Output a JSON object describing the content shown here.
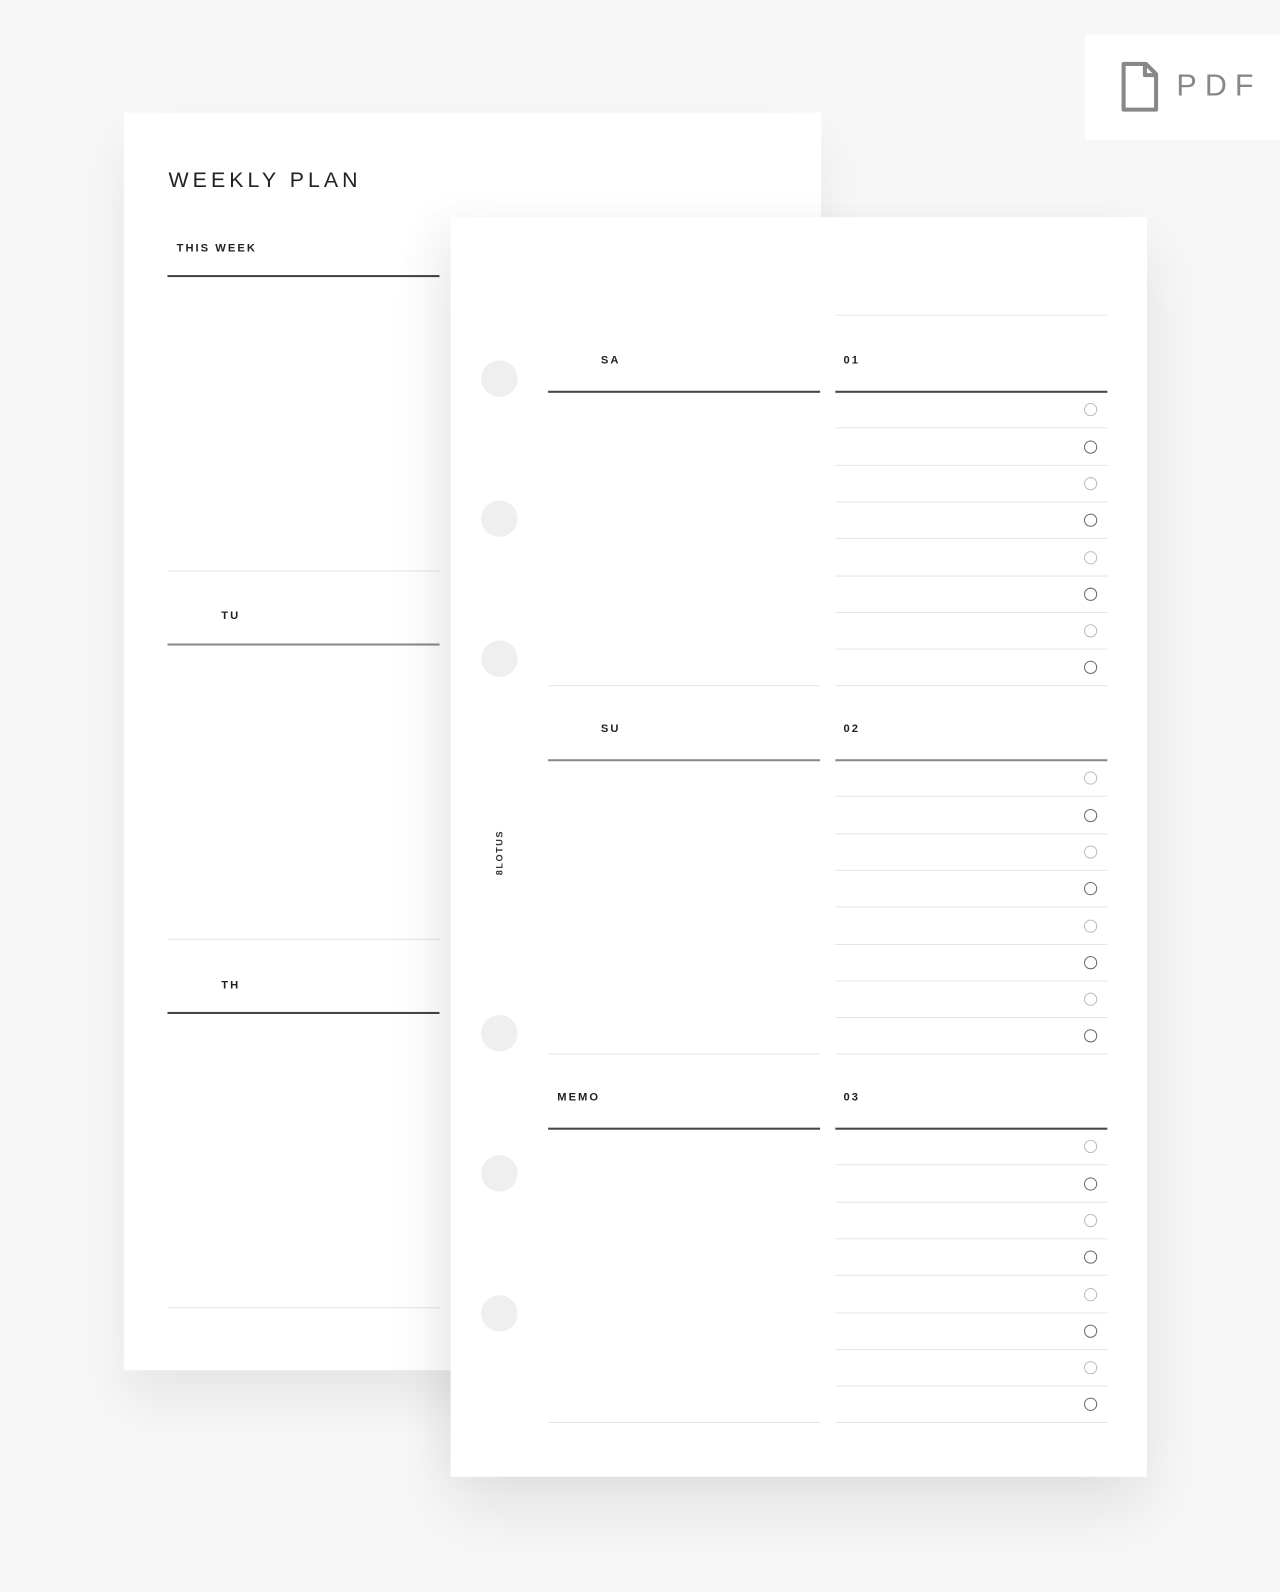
{
  "badge": {
    "label": "PDF",
    "icon": "file-icon"
  },
  "back_page": {
    "title": "WEEKLY PLAN",
    "sections": [
      "THIS WEEK",
      "TU",
      "TH"
    ]
  },
  "front_page": {
    "brand": "8LOTUS",
    "left_sections": [
      "SA",
      "SU",
      "MEMO"
    ],
    "right_sections": [
      "01",
      "02",
      "03"
    ],
    "checkboxes_per_section": 8
  },
  "colors": {
    "background": "#f7f7f7",
    "paper": "#ffffff",
    "ink": "#222222",
    "badge": "#888888"
  }
}
